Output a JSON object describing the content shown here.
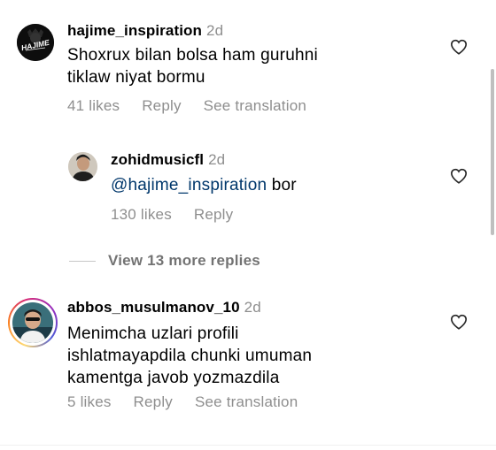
{
  "comments": [
    {
      "username": "hajime_inspiration",
      "age": "2d",
      "text": "Shoxrux bilan bolsa ham guruhni tiklaw niyat bormu",
      "likes": "41 likes",
      "reply": "Reply",
      "translate": "See translation",
      "avatar_label": "HAJIME"
    },
    {
      "username": "zohidmusicfl",
      "age": "2d",
      "mention": "@hajime_inspiration",
      "text": " bor",
      "likes": "130 likes",
      "reply": "Reply"
    },
    {
      "username": "abbos_musulmanov_10",
      "age": "2d",
      "text": "Menimcha uzlari profili ishlatmayapdila chunki umuman kamentga javob yozmazdila",
      "likes": "5 likes",
      "reply": "Reply",
      "translate": "See translation"
    }
  ],
  "view_more": "View 13 more replies",
  "colors": {
    "meta": "#8e8e8e",
    "mention": "#00376b",
    "divider": "#c7c7c7"
  },
  "icons": {
    "like": "heart-outline-icon"
  }
}
